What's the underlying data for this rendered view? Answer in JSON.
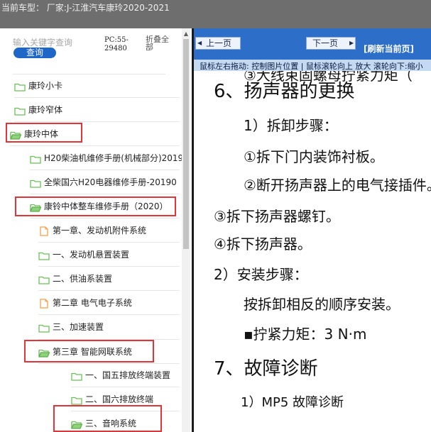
{
  "window": {
    "title": "当前车型：  厂家:J-江淮汽车康玲2020-2021"
  },
  "left_panel": {
    "search_placeholder": "输入关键字查询",
    "query_button": "查询",
    "pc_code": "PC:55-29480",
    "collapse_all": "折叠全部",
    "tree": [
      {
        "label": "康玲小卡",
        "icon": "folder-icon"
      },
      {
        "label": "康玲窄体",
        "icon": "folder-icon"
      },
      {
        "label": "康玲中体",
        "icon": "folder-open-icon"
      },
      {
        "label": "H20柴油机维修手册(机械部分)2019",
        "icon": "folder-icon"
      },
      {
        "label": "全柴国六H20电器维修手册-20190",
        "icon": "folder-icon"
      },
      {
        "label": "康铃中体整车维修手册（2020）",
        "icon": "folder-open-icon"
      },
      {
        "label": "第一章、发动机附件系统",
        "icon": "document-icon"
      },
      {
        "label": "一、发动机悬置装置",
        "icon": "folder-icon"
      },
      {
        "label": "二、供油系装置",
        "icon": "folder-icon"
      },
      {
        "label": "第二章 电气电子系统",
        "icon": "document-icon"
      },
      {
        "label": "三、加速装置",
        "icon": "folder-icon"
      },
      {
        "label": "第三章 智能网联系统",
        "icon": "folder-open-icon"
      },
      {
        "label": "一、国五排放终端装置",
        "icon": "folder-icon"
      },
      {
        "label": "二、国六排放终端",
        "icon": "folder-icon"
      },
      {
        "label": "三、音响系统",
        "icon": "folder-open-icon"
      }
    ]
  },
  "toolbar": {
    "prev_label": "上一页",
    "next_label": "下一页",
    "refresh_label": "[刷新当前页]",
    "hint": "鼠标左右拖动: 控制图片位置 | 鼠标滚轮向上 放大  滚轮向下:缩小"
  },
  "document": {
    "lines": [
      "6、扬声器的更换",
      "1）拆卸步骤：",
      "①拆下门内装饰衬板。",
      "②断开扬声器上的电气接插件。",
      "③拆下扬声器螺钉。",
      "④拆下扬声器。",
      "2）安装步骤：",
      "按拆卸相反的顺序安装。",
      "▪拧紧力矩：3 N·m",
      "7、故障诊断",
      "1）MP5  故障诊断"
    ],
    "partial_top_line": "③大线束固螺母拧紧力矩（"
  },
  "colors": {
    "titlebar_bg": "#6e6e6e",
    "toolbar_bg": "#2d6fc8",
    "hint_bg": "#c4daf2",
    "highlight_red": "#e0363b",
    "folder_green": "#7cc46a",
    "document_orange": "#f3a04a",
    "query_button_bg": "#1f66c9"
  }
}
